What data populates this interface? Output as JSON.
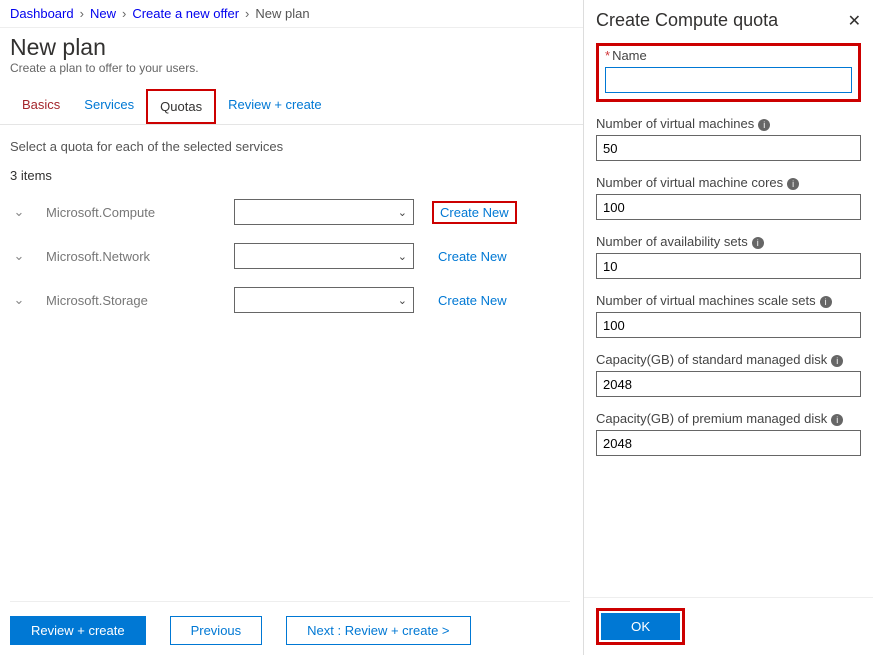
{
  "breadcrumb": [
    "Dashboard",
    "New",
    "Create a new offer",
    "New plan"
  ],
  "page": {
    "title": "New plan",
    "subtitle": "Create a plan to offer to your users."
  },
  "tabs": {
    "basics": "Basics",
    "services": "Services",
    "quotas": "Quotas",
    "review": "Review + create"
  },
  "quotasSection": {
    "hint": "Select a quota for each of the selected services",
    "itemsCount": "3 items",
    "createNew": "Create New",
    "services": [
      "Microsoft.Compute",
      "Microsoft.Network",
      "Microsoft.Storage"
    ]
  },
  "footer": {
    "review": "Review + create",
    "previous": "Previous",
    "next": "Next : Review + create >"
  },
  "panel": {
    "title": "Create Compute quota",
    "fields": {
      "name": {
        "label": "Name",
        "value": ""
      },
      "vms": {
        "label": "Number of virtual machines",
        "value": "50"
      },
      "cores": {
        "label": "Number of virtual machine cores",
        "value": "100"
      },
      "avsets": {
        "label": "Number of availability sets",
        "value": "10"
      },
      "scalesets": {
        "label": "Number of virtual machines scale sets",
        "value": "100"
      },
      "stddisk": {
        "label": "Capacity(GB) of standard managed disk",
        "value": "2048"
      },
      "premdisk": {
        "label": "Capacity(GB) of premium managed disk",
        "value": "2048"
      }
    },
    "ok": "OK"
  }
}
